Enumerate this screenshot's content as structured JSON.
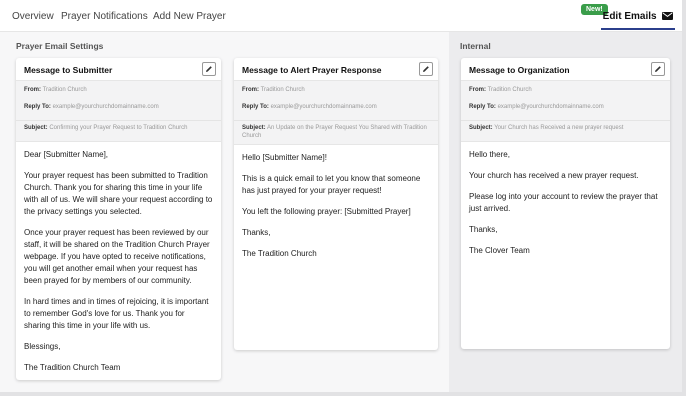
{
  "tabs": [
    {
      "label": "Overview"
    },
    {
      "label": "Prayer Notifications"
    },
    {
      "label": "Add New Prayer"
    },
    {
      "label": "Edit Emails",
      "badge": "New!"
    }
  ],
  "sections": {
    "prayer_email_settings": "Prayer Email Settings",
    "internal": "Internal"
  },
  "labels": {
    "from": "From:",
    "reply_to": "Reply To:",
    "subject": "Subject:"
  },
  "cards": [
    {
      "title": "Message to Submitter",
      "from": "Tradition Church",
      "reply_to": "example@yourchurchdomainname.com",
      "subject": "Confirming your Prayer Request to Tradition Church",
      "body": [
        "Dear [Submitter Name],",
        "Your prayer request has been submitted to Tradition Church. Thank you for sharing this time in your life with all of us. We will share your request according to the privacy settings you selected.",
        "Once your prayer request has been reviewed by our staff, it will be shared on the Tradition Church Prayer webpage. If you have opted to receive notifications, you will get another email when your request has been prayed for by members of our community.",
        "In hard times and in times of rejoicing, it is important to remember God's love for us. Thank you for sharing this time in your life with us.",
        "Blessings,",
        "The Tradition Church Team"
      ]
    },
    {
      "title": "Message to Alert Prayer Response",
      "from": "Tradition Church",
      "reply_to": "example@yourchurchdomainname.com",
      "subject": "An Update on the Prayer Request You Shared with Tradition Church",
      "body": [
        "Hello [Submitter Name]!",
        "This is a quick email to let you know that someone has just prayed for your prayer request!",
        "You left the following prayer: [Submitted Prayer]",
        "Thanks,",
        "The Tradition Church"
      ]
    },
    {
      "title": "Message to Organization",
      "from": "Tradition Church",
      "reply_to": "example@yourchurchdomainname.com",
      "subject": "Your Church has Received a new prayer request",
      "body": [
        "Hello there,",
        "Your church has received a new prayer request.",
        "Please log into your account to review the prayer that just arrived.",
        "Thanks,",
        "The Clover Team"
      ]
    }
  ]
}
